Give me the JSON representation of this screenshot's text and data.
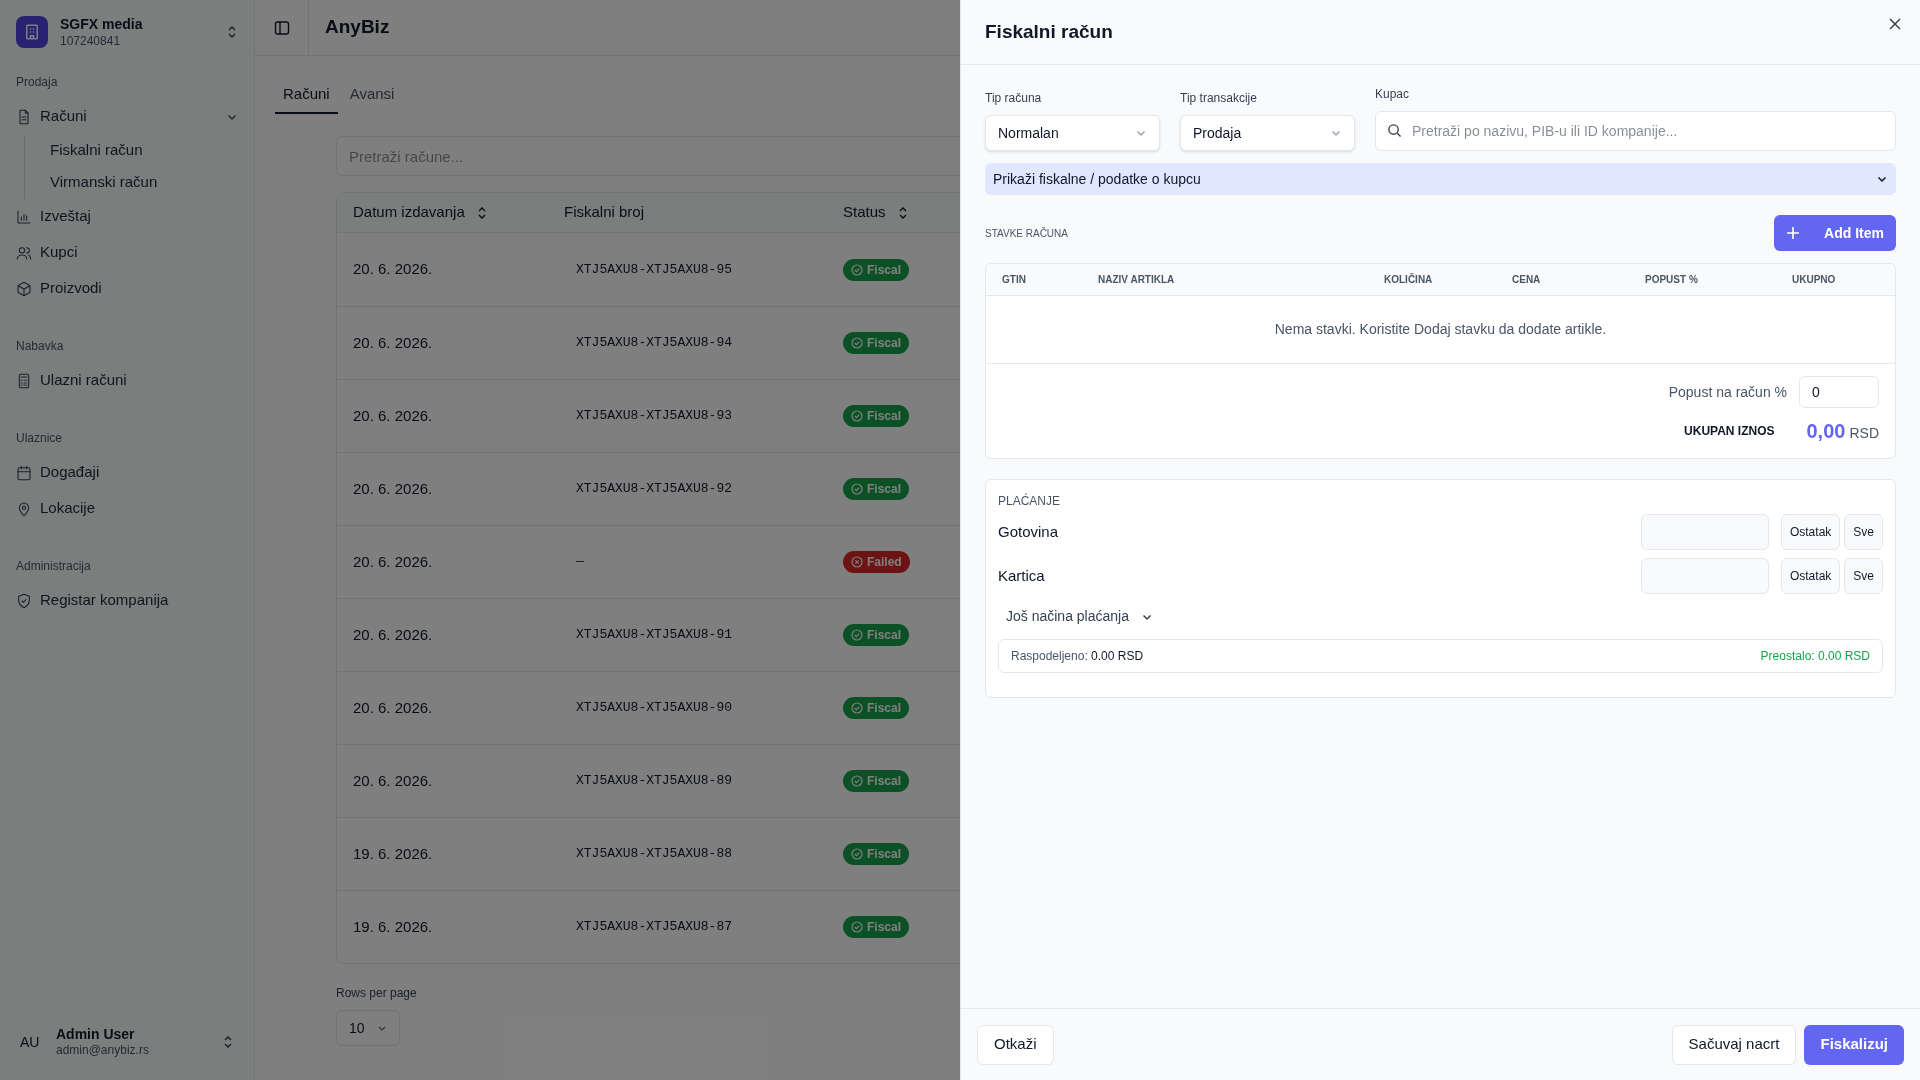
{
  "sidebar": {
    "org": {
      "name": "SGFX media",
      "id": "107240841"
    },
    "sections": [
      {
        "title": "Prodaja",
        "items": [
          {
            "label": "Računi",
            "expanded": true,
            "children": [
              {
                "label": "Fiskalni račun"
              },
              {
                "label": "Virmanski račun"
              }
            ]
          },
          {
            "label": "Izveštaj"
          },
          {
            "label": "Kupci"
          },
          {
            "label": "Proizvodi"
          }
        ]
      },
      {
        "title": "Nabavka",
        "items": [
          {
            "label": "Ulazni računi"
          }
        ]
      },
      {
        "title": "Ulaznice",
        "items": [
          {
            "label": "Događaji"
          },
          {
            "label": "Lokacije"
          }
        ]
      },
      {
        "title": "Administracija",
        "items": [
          {
            "label": "Registar kompanija"
          }
        ]
      }
    ],
    "user": {
      "initials": "AU",
      "name": "Admin User",
      "email": "admin@anybiz.rs"
    }
  },
  "header": {
    "title": "AnyBiz"
  },
  "tabs": [
    {
      "label": "Računi",
      "selected": true
    },
    {
      "label": "Avansi",
      "selected": false
    }
  ],
  "search": {
    "placeholder": "Pretraži račune..."
  },
  "table": {
    "columns": [
      {
        "label": "Datum izdavanja",
        "sortable": true
      },
      {
        "label": "Fiskalni broj",
        "sortable": false
      },
      {
        "label": "Status",
        "sortable": true
      }
    ],
    "rows": [
      {
        "date": "20. 6. 2026.",
        "number": "XTJ5AXU8-XTJ5AXU8-95",
        "status": "Fiscal",
        "kind": "fiscal"
      },
      {
        "date": "20. 6. 2026.",
        "number": "XTJ5AXU8-XTJ5AXU8-94",
        "status": "Fiscal",
        "kind": "fiscal"
      },
      {
        "date": "20. 6. 2026.",
        "number": "XTJ5AXU8-XTJ5AXU8-93",
        "status": "Fiscal",
        "kind": "fiscal"
      },
      {
        "date": "20. 6. 2026.",
        "number": "XTJ5AXU8-XTJ5AXU8-92",
        "status": "Fiscal",
        "kind": "fiscal"
      },
      {
        "date": "20. 6. 2026.",
        "number": "—",
        "status": "Failed",
        "kind": "failed"
      },
      {
        "date": "20. 6. 2026.",
        "number": "XTJ5AXU8-XTJ5AXU8-91",
        "status": "Fiscal",
        "kind": "fiscal"
      },
      {
        "date": "20. 6. 2026.",
        "number": "XTJ5AXU8-XTJ5AXU8-90",
        "status": "Fiscal",
        "kind": "fiscal"
      },
      {
        "date": "20. 6. 2026.",
        "number": "XTJ5AXU8-XTJ5AXU8-89",
        "status": "Fiscal",
        "kind": "fiscal"
      },
      {
        "date": "19. 6. 2026.",
        "number": "XTJ5AXU8-XTJ5AXU8-88",
        "status": "Fiscal",
        "kind": "fiscal"
      },
      {
        "date": "19. 6. 2026.",
        "number": "XTJ5AXU8-XTJ5AXU8-87",
        "status": "Fiscal",
        "kind": "fiscal"
      }
    ]
  },
  "pagination": {
    "label": "Rows per page",
    "value": "10"
  },
  "sheet": {
    "title": "Fiskalni račun",
    "fields": [
      {
        "label": "Tip računa",
        "value": "Normalan"
      },
      {
        "label": "Tip transakcije",
        "value": "Prodaja"
      }
    ],
    "customer": {
      "label": "Kupac",
      "placeholder": "Pretraži po nazivu, PIB-u ili ID kompanije..."
    },
    "disclosure": {
      "label": "Prikaži fiskalne / podatke o kupcu",
      "expanded": false
    },
    "items": {
      "title": "STAVKE RAČUNA",
      "add_button": "Add Item",
      "columns": [
        "GTIN",
        "NAZIV ARTIKLA",
        "KOLIČINA",
        "CENA",
        "POPUST %",
        "UKUPNO"
      ],
      "empty_text": "Nema stavki. Koristite Dodaj stavku da dodate artikle.",
      "discount": {
        "label": "Popust na račun %",
        "value": "0"
      },
      "total": {
        "label": "UKUPAN IZNOS",
        "amount": "0,00",
        "currency": "RSD"
      }
    },
    "payment": {
      "title": "PLAĆANJE",
      "methods": [
        {
          "label": "Gotovina",
          "buttons": [
            "Ostatak",
            "Sve"
          ]
        },
        {
          "label": "Kartica",
          "buttons": [
            "Ostatak",
            "Sve"
          ]
        }
      ],
      "more": "Još načina plaćanja",
      "allocated": {
        "label": "Raspodeljeno:",
        "value": "0.00 RSD"
      },
      "remaining": "Preostalo: 0.00 RSD"
    },
    "footer": {
      "cancel": "Otkaži",
      "draft": "Sačuvaj nacrt",
      "submit": "Fiskalizuj"
    }
  }
}
